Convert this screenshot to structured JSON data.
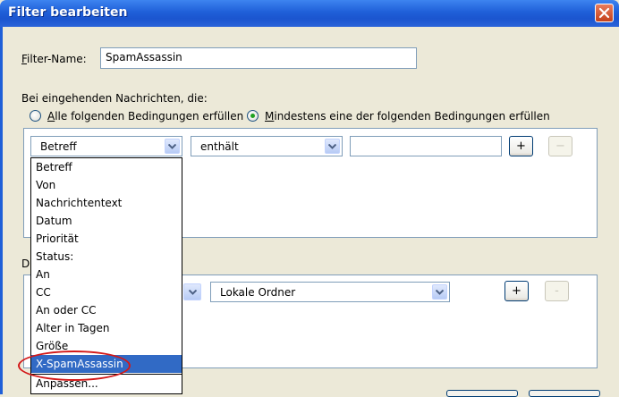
{
  "window": {
    "title": "Filter bearbeiten"
  },
  "filter_name": {
    "label_mnemonic": "F",
    "label_rest": "ilter-Name:",
    "value": "SpamAssassin"
  },
  "incoming": {
    "label": "Bei eingehenden Nachrichten, die:",
    "all_mnemonic": "A",
    "all_rest": "lle folgenden Bedingungen erfüllen",
    "any_mnemonic": "M",
    "any_rest": "indestens eine der folgenden Bedingungen erfüllen"
  },
  "condition": {
    "field_value": "Betreff",
    "operator_value": "enthält",
    "match_value": "",
    "add_label": "+",
    "remove_label": "−"
  },
  "actions_label_fragment": "D",
  "action": {
    "target_value": "Lokale Ordner",
    "add_label": "+",
    "remove_label": "-"
  },
  "dropdown": {
    "items": [
      "Betreff",
      "Von",
      "Nachrichtentext",
      "Datum",
      "Priorität",
      "Status:",
      "An",
      "CC",
      "An oder CC",
      "Alter in Tagen",
      "Größe",
      "X-SpamAssassin",
      "Anpassen..."
    ],
    "selected": "X-SpamAssassin"
  },
  "colors": {
    "titlebar": "#1f5fd8",
    "selection": "#316ac5",
    "highlight_ellipse": "#d31919"
  },
  "icons": {
    "close": "close-icon",
    "dropdown": "chevron-down-icon"
  }
}
